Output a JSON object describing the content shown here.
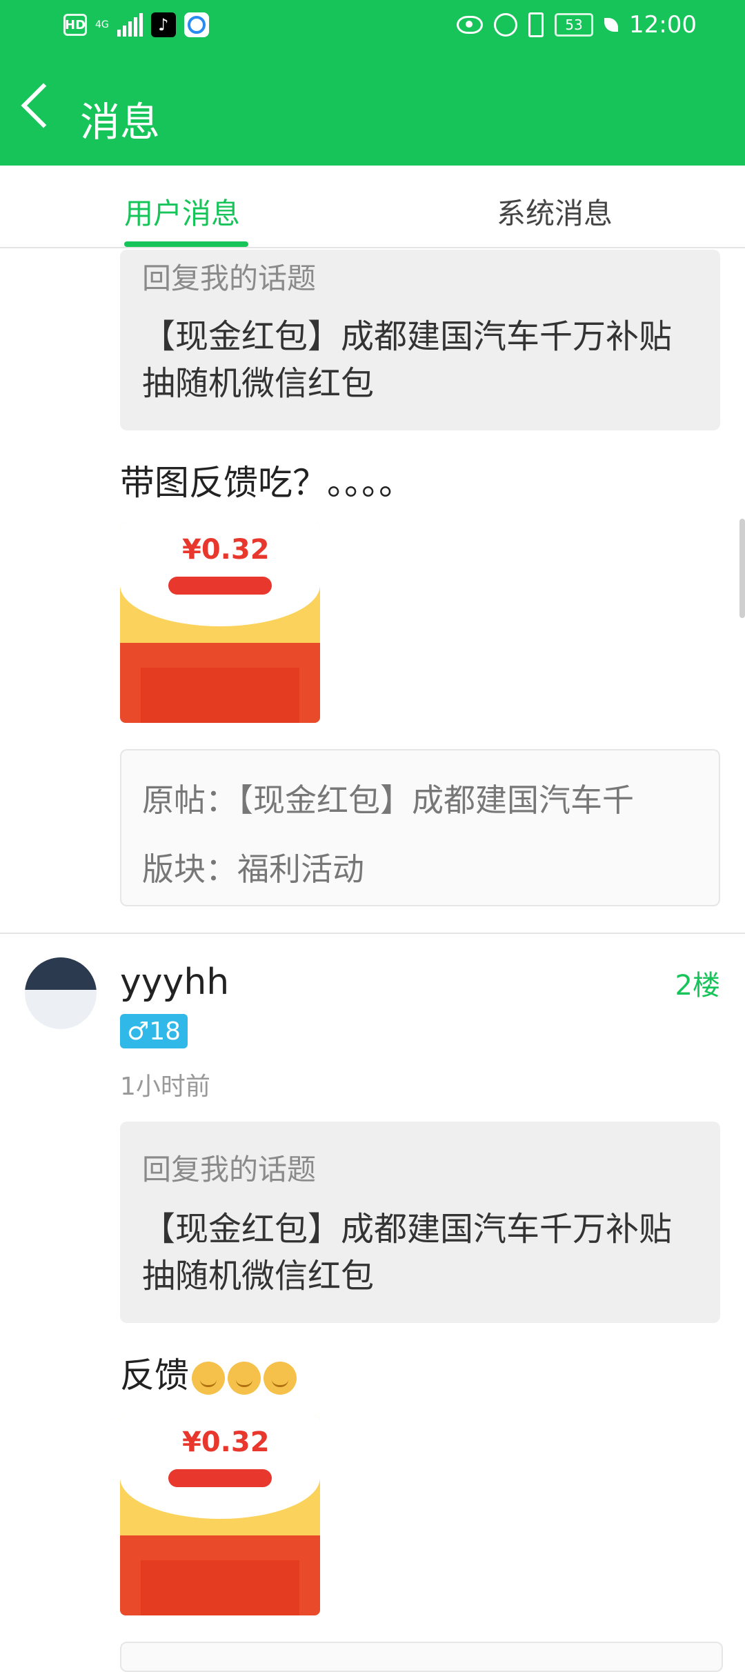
{
  "status_bar": {
    "hd": "HD",
    "network": "4G",
    "battery": "53",
    "time": "12:00"
  },
  "header": {
    "title": "消息"
  },
  "tabs": [
    {
      "label": "用户消息",
      "active": true
    },
    {
      "label": "系统消息",
      "active": false
    }
  ],
  "items": [
    {
      "quote_head": "回复我的话题",
      "quote_title": "【现金红包】成都建国汽车千万补贴抽随机微信红包",
      "message": "带图反馈吃？。。。。",
      "thumb_amount": "¥0.32",
      "origin_line": "原帖：【现金红包】成都建国汽车千",
      "board_line": "版块：福利活动"
    },
    {
      "username": "yyyhh",
      "floor": "2楼",
      "gender": "♂18",
      "time_ago": "1小时前",
      "quote_head": "回复我的话题",
      "quote_title": "【现金红包】成都建国汽车千万补贴抽随机微信红包",
      "message": "反馈",
      "thumb_amount": "¥0.32"
    }
  ],
  "colors": {
    "accent": "#17c45a",
    "gender_badge": "#2fb8e8"
  }
}
